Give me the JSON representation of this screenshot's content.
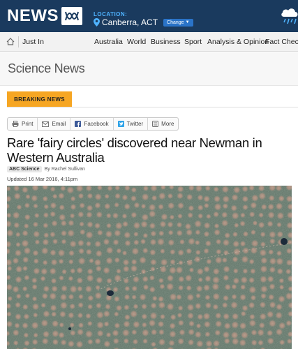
{
  "header": {
    "logo_text": "NEWS",
    "location_label": "LOCATION:",
    "location_city": "Canberra, ACT",
    "change_label": "Change"
  },
  "nav": {
    "home_icon": "home-icon",
    "items": [
      "Just In",
      "Australia",
      "World",
      "Business",
      "Sport",
      "Analysis & Opinion",
      "Fact Chec"
    ]
  },
  "section": {
    "title": "Science News"
  },
  "breaking": {
    "label": "BREAKING NEWS"
  },
  "share": {
    "print": "Print",
    "email": "Email",
    "facebook": "Facebook",
    "twitter": "Twitter",
    "more": "More"
  },
  "article": {
    "headline": "Rare 'fairy circles' discovered near Newman in Western Australia",
    "tag": "ABC Science",
    "byline": "By Rachel Sullivan",
    "updated": "Updated 16 Mar 2016, 4:11pm"
  },
  "colors": {
    "header_bg": "#1a3a5e",
    "accent_blue": "#4fb3ff",
    "breaking_orange": "#f6a623"
  }
}
